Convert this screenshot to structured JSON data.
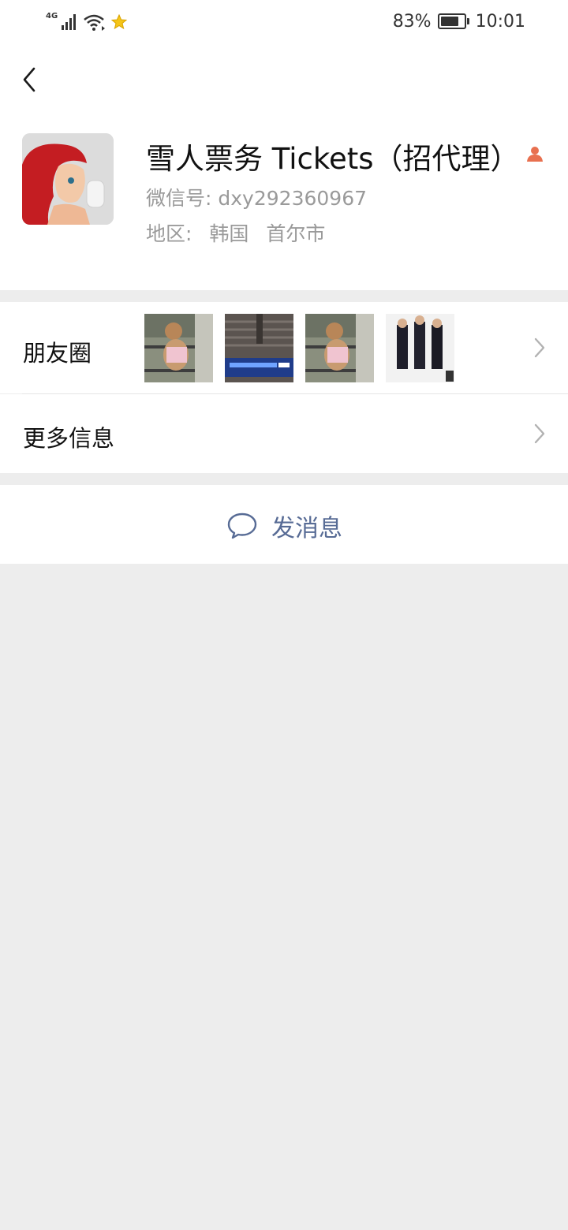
{
  "status_bar": {
    "network": "4G",
    "battery_percent": "83%",
    "battery_level": 0.83,
    "time": "10:01",
    "icons": [
      "signal-icon",
      "wifi-icon",
      "star-notification-icon",
      "battery-icon"
    ]
  },
  "profile": {
    "name": "雪人票务 Tickets（招代理）",
    "wechat_id_label": "微信号:",
    "wechat_id": "dxy292360967",
    "region_label": "地区:",
    "region_country": "韩国",
    "region_city": "首尔市",
    "badge_icon": "contact-person-icon"
  },
  "moments": {
    "label": "朋友圈",
    "thumbnails": [
      "teddy-bear-photo",
      "airport-board-photo",
      "teddy-bear-photo",
      "group-photo"
    ]
  },
  "more_info": {
    "label": "更多信息"
  },
  "send_message": {
    "label": "发消息",
    "icon": "chat-bubble-icon"
  },
  "colors": {
    "link_blue": "#576b95",
    "background": "#ededed",
    "badge_orange": "#e8704f"
  }
}
